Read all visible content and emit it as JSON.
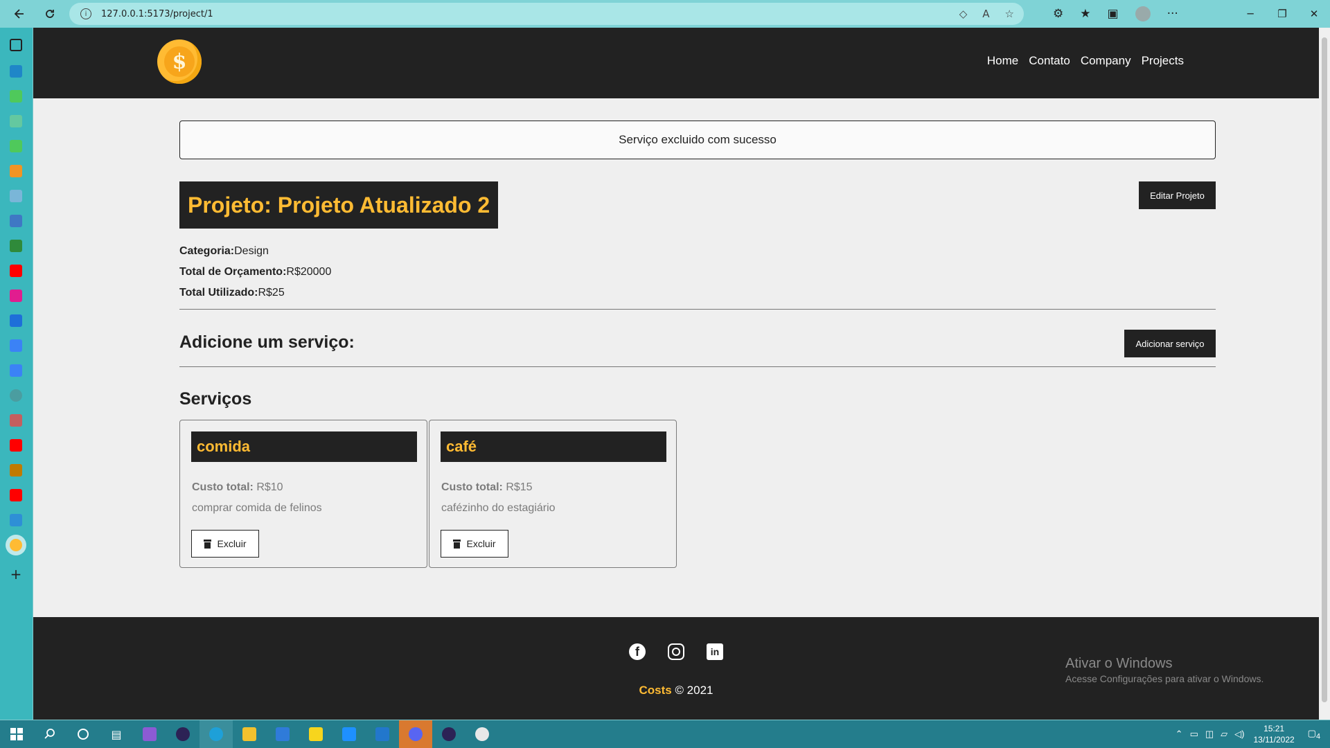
{
  "browser": {
    "url": "127.0.0.1:5173/project/1",
    "back_icon": "arrow-left-icon",
    "refresh_icon": "refresh-icon"
  },
  "navbar": {
    "logo_symbol": "$",
    "links": [
      "Home",
      "Contato",
      "Company",
      "Projects"
    ]
  },
  "message": "Serviço excluido com sucesso",
  "project": {
    "title": "Projeto: Projeto Atualizado 2",
    "edit_label": "Editar Projeto",
    "category_label": "Categoria:",
    "category_value": "Design",
    "budget_label": "Total de Orçamento:",
    "budget_value": "R$20000",
    "used_label": "Total Utilizado:",
    "used_value": "R$25"
  },
  "add_service": {
    "title": "Adicione um serviço:",
    "button_label": "Adicionar serviço"
  },
  "services": {
    "title": "Serviços",
    "cost_label": "Custo total:",
    "delete_label": "Excluir",
    "items": [
      {
        "name": "comida",
        "cost": "R$10",
        "description": "comprar comida de felinos"
      },
      {
        "name": "café",
        "cost": "R$15",
        "description": "cafézinho do estagiário"
      }
    ]
  },
  "footer": {
    "brand": "Costs",
    "copyright": "© 2021",
    "social_icons": [
      "facebook-icon",
      "instagram-icon",
      "linkedin-icon"
    ]
  },
  "watermark": {
    "line1": "Ativar o Windows",
    "line2": "Acesse Configurações para ativar o Windows."
  },
  "taskbar": {
    "time": "15:21",
    "date": "13/11/2022",
    "notifications": "4"
  },
  "colors": {
    "accent": "#ffbb33",
    "dark": "#222222",
    "page_bg": "#efefef",
    "browser_bar": "#7fd3d6"
  }
}
